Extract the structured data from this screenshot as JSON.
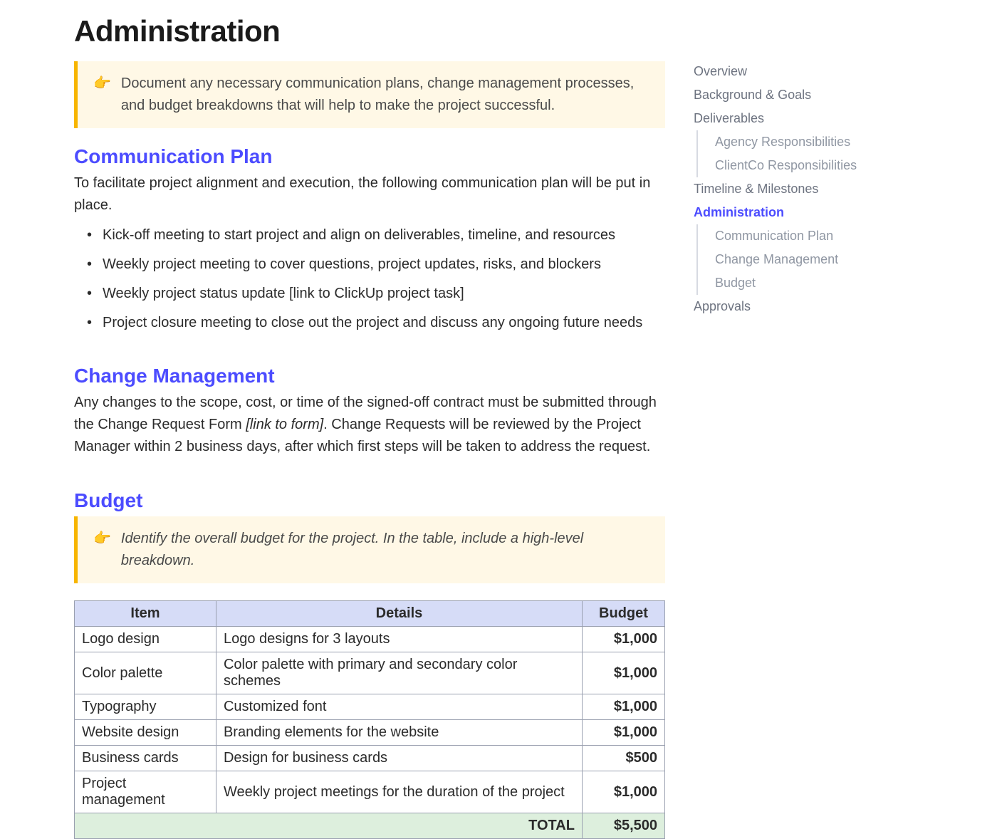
{
  "heading": "Administration",
  "callout_main": "Document any necessary communication plans, change management processes, and budget breakdowns that will help to make the project successful.",
  "comm_plan": {
    "title": "Communication Plan",
    "intro": "To facilitate project alignment and execution, the following communication plan will be put in place.",
    "items": [
      "Kick-off meeting to start project and align on deliverables, timeline, and resources",
      "Weekly project meeting to cover questions, project updates, risks, and blockers",
      "Weekly project status update ",
      "Project closure meeting to close out the project and discuss any ongoing future needs"
    ],
    "item3_link": "[link to ClickUp project task]"
  },
  "change_mgmt": {
    "title": "Change Management",
    "text_a": "Any changes to the scope, cost, or time of the signed-off contract must be submitted through the Change Request Form ",
    "text_link": "[link to form]",
    "text_b": ". Change Requests will be reviewed by the Project Manager within 2 business days, after which first steps will be taken to address the request."
  },
  "budget": {
    "title": "Budget",
    "callout": "Identify the overall budget for the project. In the table, include a high-level breakdown.",
    "columns": [
      "Item",
      "Details",
      "Budget"
    ],
    "rows": [
      {
        "item": "Logo design",
        "details": "Logo designs for 3 layouts",
        "amount": "$1,000"
      },
      {
        "item": "Color palette",
        "details": "Color palette with primary and secondary color schemes",
        "amount": "$1,000"
      },
      {
        "item": "Typography",
        "details": "Customized font",
        "amount": "$1,000"
      },
      {
        "item": "Website design",
        "details": "Branding elements for the website",
        "amount": "$1,000"
      },
      {
        "item": "Business cards",
        "details": "Design for business cards",
        "amount": "$500"
      },
      {
        "item": "Project management",
        "details": "Weekly project meetings for the duration of the project",
        "amount": "$1,000"
      }
    ],
    "total_label": "TOTAL",
    "total_amount": "$5,500"
  },
  "toc": [
    {
      "label": "Overview",
      "level": 1,
      "active": false
    },
    {
      "label": "Background & Goals",
      "level": 1,
      "active": false
    },
    {
      "label": "Deliverables",
      "level": 1,
      "active": false
    },
    {
      "label": "Agency Responsibilities",
      "level": 2,
      "active": false
    },
    {
      "label": "ClientCo Responsibilities",
      "level": 2,
      "active": false
    },
    {
      "label": "Timeline & Milestones",
      "level": 1,
      "active": false
    },
    {
      "label": "Administration",
      "level": 1,
      "active": true
    },
    {
      "label": "Communication Plan",
      "level": 2,
      "active": false
    },
    {
      "label": "Change Management",
      "level": 2,
      "active": false
    },
    {
      "label": "Budget",
      "level": 2,
      "active": false
    },
    {
      "label": "Approvals",
      "level": 1,
      "active": false
    }
  ]
}
